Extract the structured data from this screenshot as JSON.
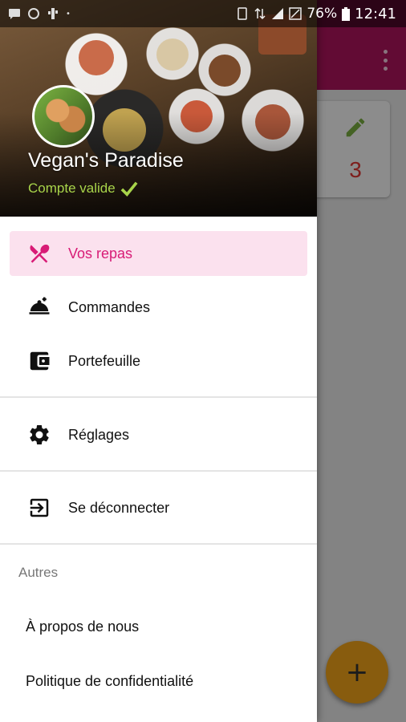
{
  "status_bar": {
    "battery": "76%",
    "time": "12:41"
  },
  "background_app": {
    "toolbar_color": "#b3155f",
    "card_count": "3",
    "fab_label": "+"
  },
  "drawer": {
    "restaurant_name": "Vegan's Paradise",
    "account_status": "Compte valide",
    "menu": [
      {
        "label": "Vos repas",
        "icon": "restaurant-icon",
        "active": true
      },
      {
        "label": "Commandes",
        "icon": "room-service-icon"
      },
      {
        "label": "Portefeuille",
        "icon": "wallet-icon"
      },
      {
        "label": "Réglages",
        "icon": "gear-icon"
      },
      {
        "label": "Se déconnecter",
        "icon": "logout-icon"
      }
    ],
    "others_section": {
      "title": "Autres",
      "items": [
        "À propos de nous",
        "Politique de confidentialité"
      ]
    }
  },
  "colors": {
    "accent": "#d81b76",
    "active_bg": "#fbe1ee",
    "status_ok": "#a8d44a",
    "fab": "#f7a81b"
  }
}
